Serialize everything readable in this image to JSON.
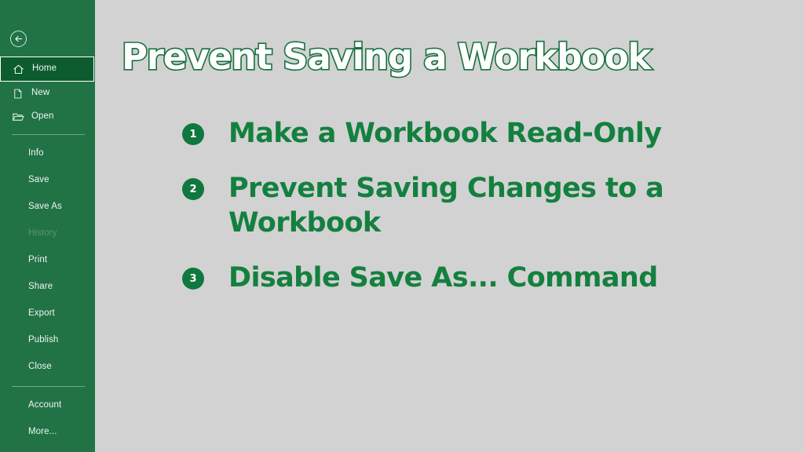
{
  "app": {
    "theme_color": "#217346",
    "accent_green": "#14803f",
    "canvas_background": "#d2d2d2",
    "active_item_background": "#0d5c30"
  },
  "sidebar": {
    "back_button": {
      "name": "back-arrow",
      "icon": "back-arrow-icon"
    },
    "items": [
      {
        "label": "Home",
        "icon": "home-icon",
        "state": "active",
        "style": "with-icon"
      },
      {
        "label": "New",
        "icon": "new-file-icon",
        "state": "normal",
        "style": "with-icon"
      },
      {
        "label": "Open",
        "icon": "open-folder-icon",
        "state": "normal",
        "style": "with-icon"
      },
      {
        "label": "Info",
        "icon": "",
        "state": "normal",
        "style": "plain"
      },
      {
        "label": "Save",
        "icon": "",
        "state": "normal",
        "style": "plain"
      },
      {
        "label": "Save As",
        "icon": "",
        "state": "normal",
        "style": "plain"
      },
      {
        "label": "History",
        "icon": "",
        "state": "disabled",
        "style": "plain"
      },
      {
        "label": "Print",
        "icon": "",
        "state": "normal",
        "style": "plain"
      },
      {
        "label": "Share",
        "icon": "",
        "state": "normal",
        "style": "plain"
      },
      {
        "label": "Export",
        "icon": "",
        "state": "normal",
        "style": "plain"
      },
      {
        "label": "Publish",
        "icon": "",
        "state": "normal",
        "style": "plain"
      },
      {
        "label": "Close",
        "icon": "",
        "state": "normal",
        "style": "plain"
      },
      {
        "label": "Account",
        "icon": "",
        "state": "normal",
        "style": "plain"
      },
      {
        "label": "More...",
        "icon": "",
        "state": "normal",
        "style": "plain"
      }
    ]
  },
  "main": {
    "title": "Prevent Saving a Workbook",
    "bullets": [
      {
        "number": "1",
        "text": "Make a Workbook Read-Only"
      },
      {
        "number": "2",
        "text": "Prevent Saving Changes to a Workbook"
      },
      {
        "number": "3",
        "text": "Disable Save As... Command"
      }
    ]
  }
}
